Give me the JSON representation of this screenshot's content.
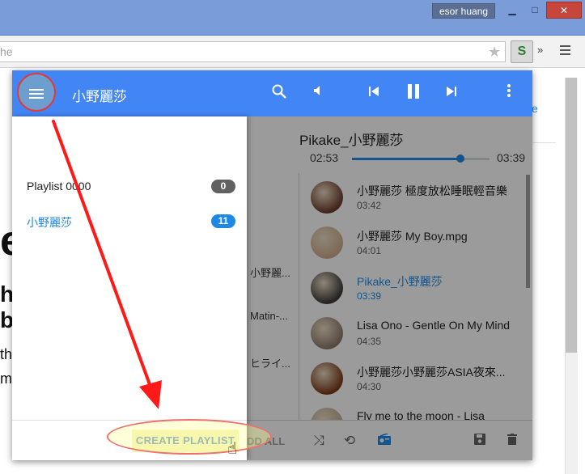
{
  "window": {
    "user_name": "esor huang",
    "min_label": "▁",
    "max_label": "□",
    "close_label": "✕"
  },
  "browser": {
    "omnibox_text": "he",
    "ext_more_label": "»"
  },
  "background_page": {
    "big_text": "e,",
    "line1": "he",
    "line2": "b",
    "line3": "th",
    "line4": "ma",
    "link_text": "e"
  },
  "app": {
    "title": "小野麗莎"
  },
  "playlists": [
    {
      "label": "Playlist 0000",
      "count": "0"
    },
    {
      "label": "小野麗莎",
      "count": "11"
    }
  ],
  "drawer": {
    "create_label": "CREATE PLAYLIST"
  },
  "player": {
    "now_playing": "Pikake_小野麗莎",
    "current_time": "02:53",
    "total_time": "03:39",
    "progress": 0.79
  },
  "middle_column": [
    "小野麗...",
    "Matin-...",
    "ヒライ..."
  ],
  "tracks": [
    {
      "title": "小野麗莎 極度放松睡眠輕音樂",
      "duration": "03:42",
      "playing": false
    },
    {
      "title": "小野麗莎 My Boy.mpg",
      "duration": "04:01",
      "playing": false
    },
    {
      "title": "Pikake_小野麗莎",
      "duration": "03:39",
      "playing": true
    },
    {
      "title": "Lisa Ono - Gentle On My Mind",
      "duration": "04:35",
      "playing": false
    },
    {
      "title": "小野麗莎小野麗莎ASIA夜來...",
      "duration": "04:30",
      "playing": false
    },
    {
      "title": "Fly me to the moon - Lisa",
      "duration": "",
      "playing": false
    }
  ],
  "bottom": {
    "add_all_label": "DD ALL"
  },
  "colors": {
    "accent": "#4285f4",
    "active": "#1e88e5",
    "annotation": "#ff1a1a"
  }
}
